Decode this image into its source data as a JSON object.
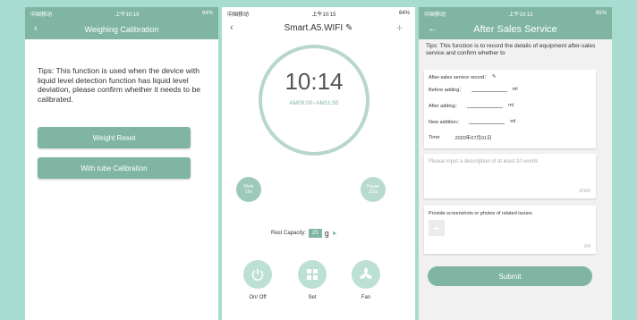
{
  "colors": {
    "accent": "#7fb5a2",
    "background": "#a7dcd0"
  },
  "status": {
    "carrier": "中国移动",
    "time1": "上午10:15",
    "time2": "上午10:15",
    "time3": "上午10:13",
    "battery1": "64%",
    "battery2": "64%",
    "battery3": "65%"
  },
  "screen1": {
    "title": "Weighing Calibration",
    "tip": "Tips: This function is used when the device with liquid level detection function has liquid level deviation, please confirm whether it needs to be calibrated.",
    "weight_reset": "Weight Reset",
    "tube_calibration": "With tube Calibration"
  },
  "screen2": {
    "title": "Smart.A5.WIFI",
    "time": "10:14",
    "range": "AM09:00~AM11:55",
    "work_label": "Work",
    "work_value": "10s",
    "pause_label": "Pause",
    "pause_value": "116s",
    "rest_label": "Rest Capacity:",
    "rest_value": "25",
    "rest_unit": "g",
    "onoff_label": "On/ Off",
    "set_label": "Set",
    "fan_label": "Fan"
  },
  "screen3": {
    "title": "After Sales Service",
    "tip": "Tips: This function is to record the details of equipment after-sales service and confirm whether to",
    "record_label": "After-sales service record：",
    "before_label": "Before adding：",
    "after_label": "After adding：",
    "new_label": "New addition：",
    "unit": "ml",
    "time_label": "Time:",
    "time_value": "2020年07月01日",
    "desc_placeholder": "Please input a description of at least 10 words",
    "desc_count": "0/100",
    "screens_label": "Provide screenshots or photos of related issues",
    "photo_count": "0/4",
    "submit": "Submit"
  }
}
